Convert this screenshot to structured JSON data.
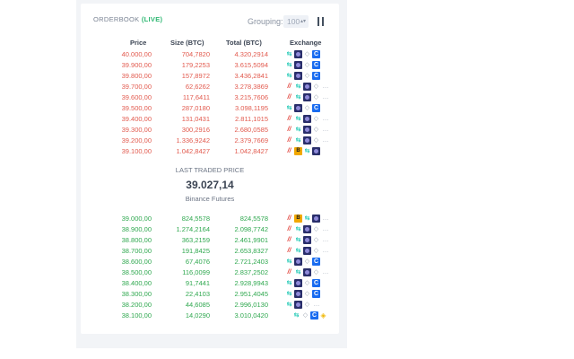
{
  "orderbook": {
    "title": "ORDERBOOK",
    "live_label": "(LIVE)",
    "grouping_label": "Grouping:",
    "grouping_value": "100",
    "columns": {
      "price": "Price",
      "size": "Size (BTC)",
      "total": "Total (BTC)",
      "exchange": "Exchange"
    },
    "colors": {
      "ask": "#e25a4e",
      "bid": "#2fa84f",
      "live": "#2eb872"
    },
    "asks": [
      {
        "price": "40.000,00",
        "size": "704,7820",
        "total": "4.320,2914",
        "exchanges": [
          "ftx-icon",
          "kraken-icon",
          "diamond-icon",
          "coinbase-icon"
        ]
      },
      {
        "price": "39.900,00",
        "size": "179,2253",
        "total": "3.615,5094",
        "exchanges": [
          "ftx-icon",
          "kraken-icon",
          "diamond-icon",
          "coinbase-icon"
        ]
      },
      {
        "price": "39.800,00",
        "size": "157,8972",
        "total": "3.436,2841",
        "exchanges": [
          "ftx-icon",
          "kraken-icon",
          "diamond-icon",
          "coinbase-icon"
        ]
      },
      {
        "price": "39.700,00",
        "size": "62,6262",
        "total": "3.278,3869",
        "exchanges": [
          "bitmex-icon",
          "ftx-icon",
          "kraken-icon",
          "diamond-icon",
          "more-icon"
        ]
      },
      {
        "price": "39.600,00",
        "size": "117,6411",
        "total": "3.215,7606",
        "exchanges": [
          "bitmex-icon",
          "ftx-icon",
          "kraken-icon",
          "diamond-icon",
          "more-icon"
        ]
      },
      {
        "price": "39.500,00",
        "size": "287,0180",
        "total": "3.098,1195",
        "exchanges": [
          "ftx-icon",
          "kraken-icon",
          "diamond-icon",
          "coinbase-icon"
        ]
      },
      {
        "price": "39.400,00",
        "size": "131,0431",
        "total": "2.811,1015",
        "exchanges": [
          "bitmex-icon",
          "ftx-icon",
          "kraken-icon",
          "diamond-icon",
          "more-icon"
        ]
      },
      {
        "price": "39.300,00",
        "size": "300,2916",
        "total": "2.680,0585",
        "exchanges": [
          "bitmex-icon",
          "ftx-icon",
          "kraken-icon",
          "diamond-icon",
          "more-icon"
        ]
      },
      {
        "price": "39.200,00",
        "size": "1.336,9242",
        "total": "2.379,7669",
        "exchanges": [
          "bitmex-icon",
          "ftx-icon",
          "kraken-icon",
          "diamond-icon",
          "more-icon"
        ]
      },
      {
        "price": "39.100,00",
        "size": "1.042,8427",
        "total": "1.042,8427",
        "exchanges": [
          "bitmex-icon",
          "bybit-icon",
          "ftx-icon",
          "kraken-icon"
        ]
      }
    ],
    "last_traded": {
      "label": "LAST TRADED PRICE",
      "value": "39.027,14",
      "source": "Binance Futures"
    },
    "bids": [
      {
        "price": "39.000,00",
        "size": "824,5578",
        "total": "824,5578",
        "exchanges": [
          "bitmex-icon",
          "bybit-icon",
          "ftx-icon",
          "kraken-icon",
          "more-icon"
        ]
      },
      {
        "price": "38.900,00",
        "size": "1.274,2164",
        "total": "2.098,7742",
        "exchanges": [
          "bitmex-icon",
          "ftx-icon",
          "kraken-icon",
          "diamond-icon",
          "more-icon"
        ]
      },
      {
        "price": "38.800,00",
        "size": "363,2159",
        "total": "2.461,9901",
        "exchanges": [
          "bitmex-icon",
          "ftx-icon",
          "kraken-icon",
          "diamond-icon",
          "more-icon"
        ]
      },
      {
        "price": "38.700,00",
        "size": "191,8425",
        "total": "2.653,8327",
        "exchanges": [
          "bitmex-icon",
          "ftx-icon",
          "kraken-icon",
          "diamond-icon",
          "more-icon"
        ]
      },
      {
        "price": "38.600,00",
        "size": "67,4076",
        "total": "2.721,2403",
        "exchanges": [
          "ftx-icon",
          "kraken-icon",
          "diamond-icon",
          "coinbase-icon"
        ]
      },
      {
        "price": "38.500,00",
        "size": "116,0099",
        "total": "2.837,2502",
        "exchanges": [
          "bitmex-icon",
          "ftx-icon",
          "kraken-icon",
          "diamond-icon",
          "more-icon"
        ]
      },
      {
        "price": "38.400,00",
        "size": "91,7441",
        "total": "2.928,9943",
        "exchanges": [
          "ftx-icon",
          "kraken-icon",
          "diamond-icon",
          "coinbase-icon"
        ]
      },
      {
        "price": "38.300,00",
        "size": "22,4103",
        "total": "2.951,4045",
        "exchanges": [
          "ftx-icon",
          "kraken-icon",
          "diamond-icon",
          "coinbase-icon"
        ]
      },
      {
        "price": "38.200,00",
        "size": "44,6085",
        "total": "2.996,0130",
        "exchanges": [
          "ftx-icon",
          "kraken-icon",
          "diamond-icon",
          "more-icon"
        ]
      },
      {
        "price": "38.100,00",
        "size": "14,0290",
        "total": "3.010,0420",
        "exchanges": [
          "ftx-icon",
          "diamond-icon",
          "coinbase-icon",
          "binance-icon"
        ]
      }
    ]
  }
}
